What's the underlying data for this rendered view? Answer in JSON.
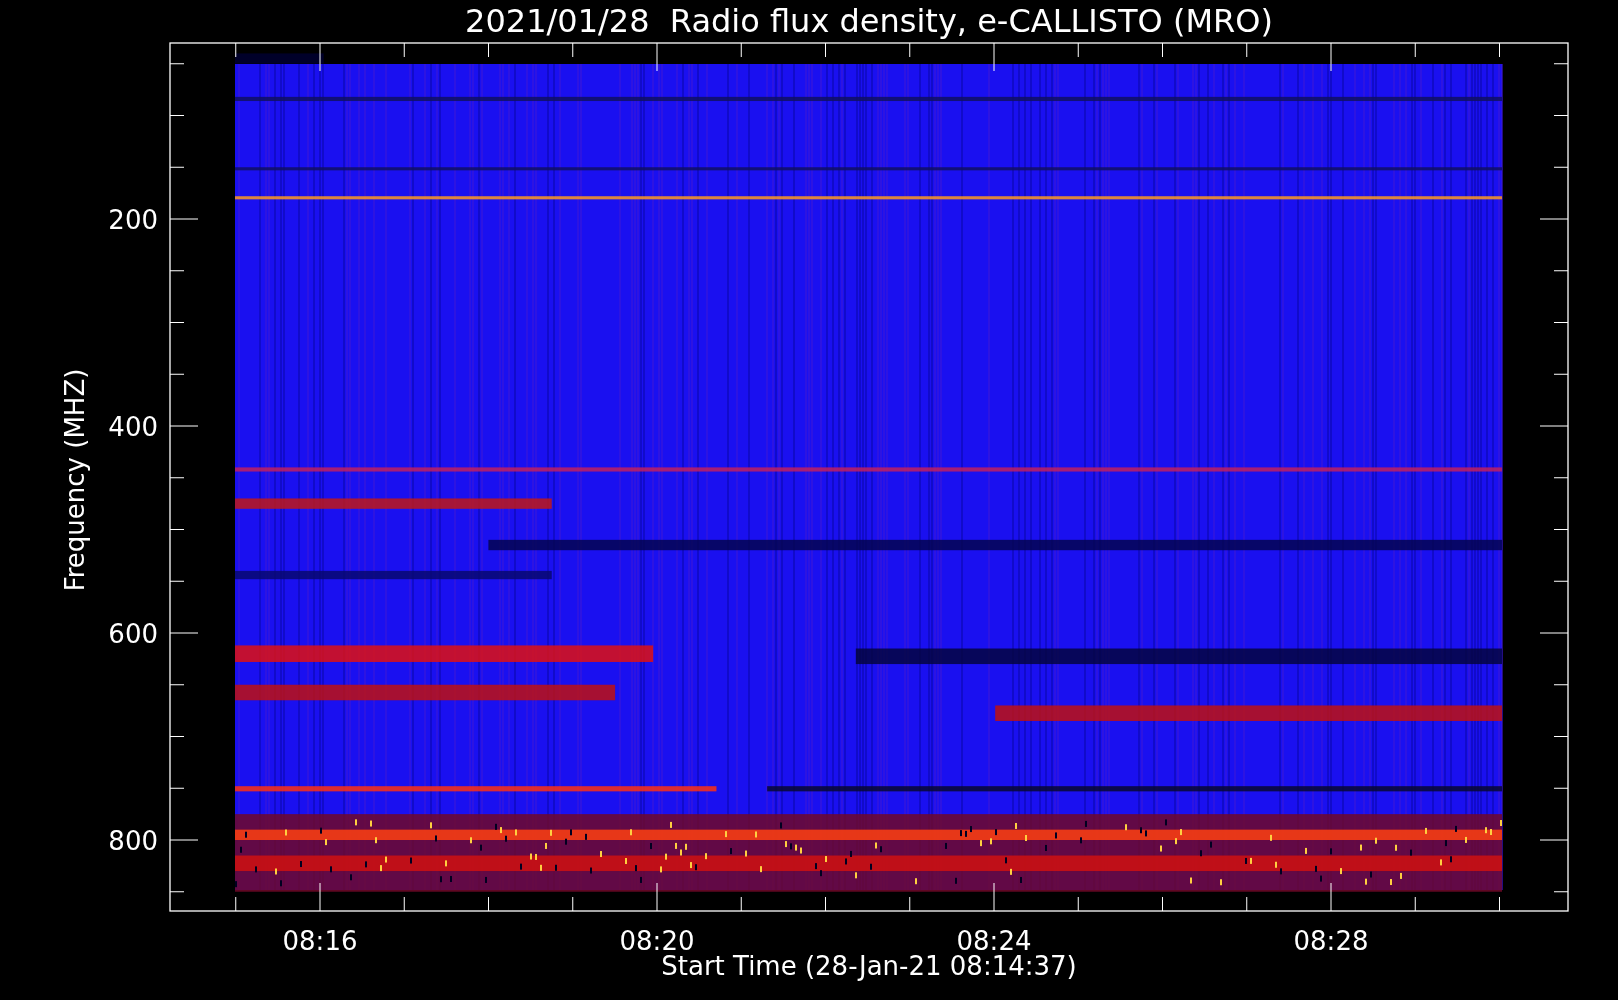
{
  "title": "2021/01/28  Radio flux density, e-CALLISTO (MRO)",
  "y_axis": {
    "label": "Frequency (MHZ)",
    "ticks": [
      "200",
      "400",
      "600",
      "800"
    ]
  },
  "x_axis": {
    "label": "Start Time (28-Jan-21 08:14:37)",
    "ticks": [
      "08:16",
      "08:20",
      "08:24",
      "08:28"
    ]
  }
}
